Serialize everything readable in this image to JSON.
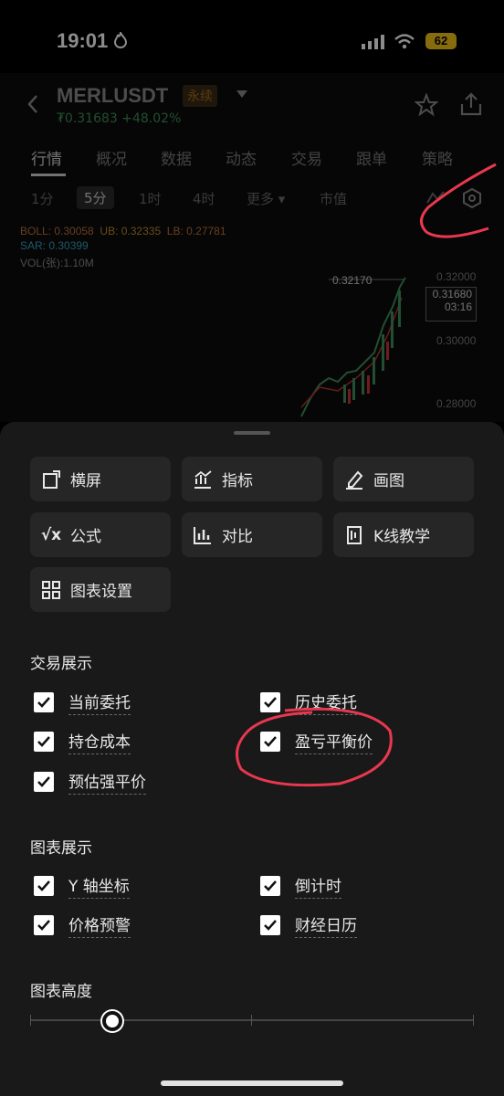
{
  "status": {
    "time": "19:01",
    "battery": "62"
  },
  "header": {
    "symbol": "MERLUSDT",
    "badge": "永续",
    "price": "₮0.31683",
    "change": "+48.02%"
  },
  "tabs": [
    "行情",
    "概况",
    "数据",
    "动态",
    "交易",
    "跟单",
    "策略"
  ],
  "intervals": [
    "1分",
    "5分",
    "1时",
    "4时",
    "更多",
    "市值"
  ],
  "indicators": {
    "boll": "BOLL: 0.30058",
    "ub": "UB: 0.32335",
    "lb": "LB: 0.27781",
    "sar": "SAR: 0.30399",
    "vol": "VOL(张):1.10M"
  },
  "yaxis": {
    "a": "0.32000",
    "b": "0.30000",
    "c": "0.28000",
    "high": "0.32170",
    "current": "0.31680",
    "countdown": "03:16"
  },
  "tools": [
    "横屏",
    "指标",
    "画图",
    "公式",
    "对比",
    "K线教学",
    "图表设置"
  ],
  "trade_section": {
    "title": "交易展示",
    "items": [
      "当前委托",
      "历史委托",
      "持仓成本",
      "盈亏平衡价",
      "预估强平价"
    ]
  },
  "chart_section": {
    "title": "图表展示",
    "items": [
      "Y 轴坐标",
      "倒计时",
      "价格预警",
      "财经日历"
    ]
  },
  "height_section": {
    "title": "图表高度"
  },
  "colors": {
    "boll": "#c0713a",
    "ub": "#c08a2a",
    "lb": "#c0713a",
    "sar": "#3aa0c0",
    "up": "#3e8e5a",
    "annotation": "#e8384f"
  }
}
